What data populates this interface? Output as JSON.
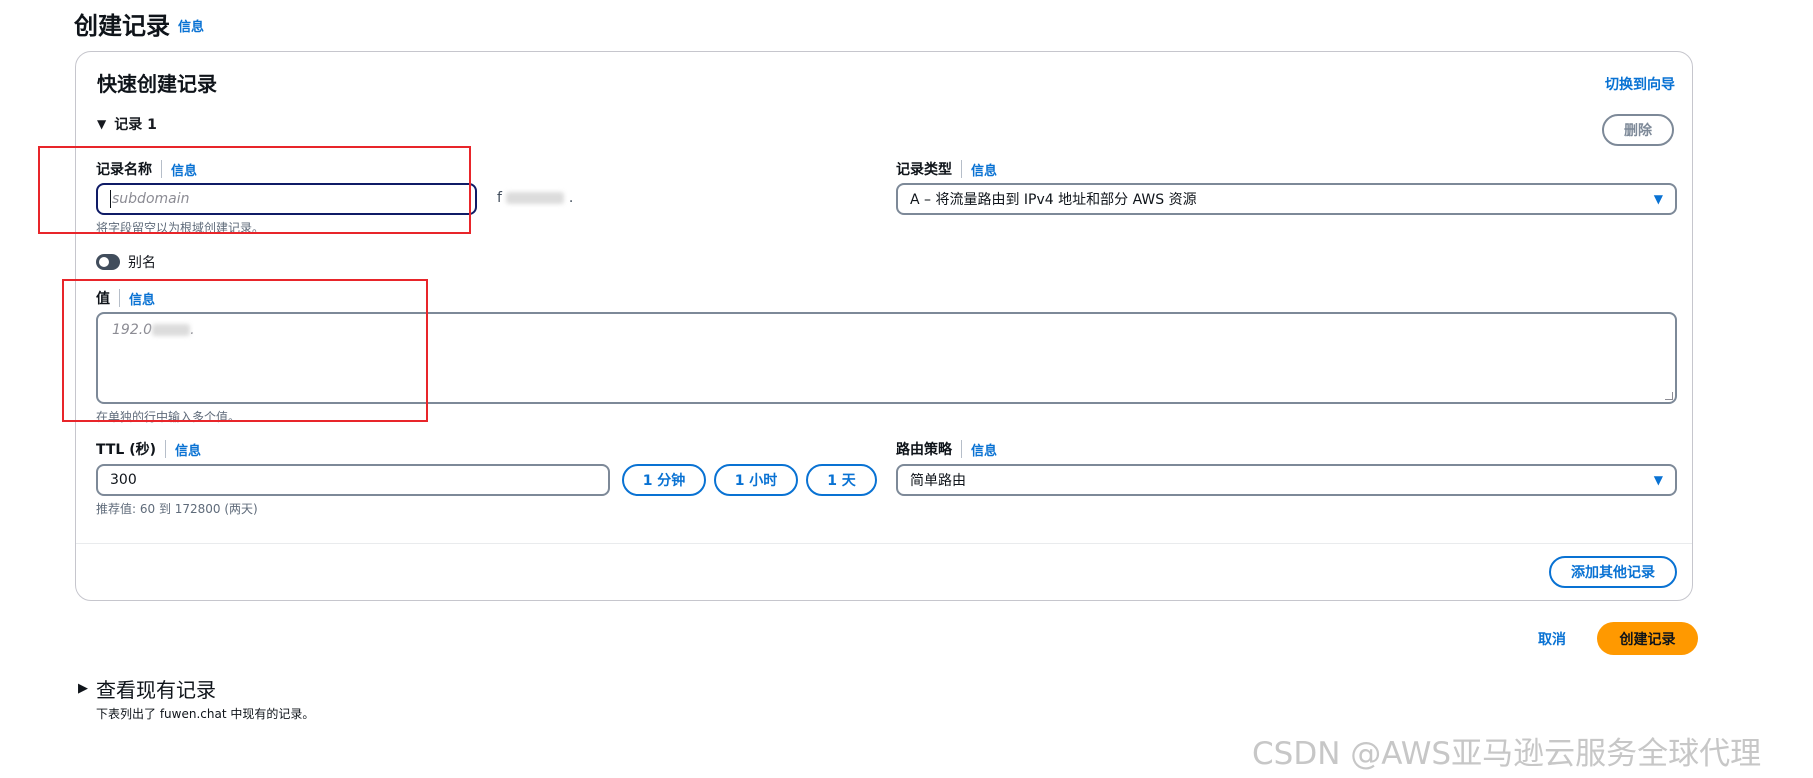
{
  "page": {
    "title": "创建记录",
    "title_info": "信息"
  },
  "panel": {
    "title": "快速创建记录",
    "switch_link": "切换到向导",
    "record_header": "记录 1",
    "delete_label": "删除",
    "add_label": "添加其他记录"
  },
  "record_name": {
    "label": "记录名称",
    "info": "信息",
    "placeholder": "subdomain",
    "suffix": "f",
    "suffix_end": ".",
    "hint": "将字段留空以为根域创建记录。"
  },
  "record_type": {
    "label": "记录类型",
    "info": "信息",
    "selected": "A – 将流量路由到 IPv4 地址和部分 AWS 资源"
  },
  "alias": {
    "label": "别名",
    "enabled": false
  },
  "value": {
    "label": "值",
    "info": "信息",
    "placeholder": "192.0",
    "placeholder_end": ".",
    "hint": "在单独的行中输入多个值。"
  },
  "ttl": {
    "label": "TTL (秒)",
    "info": "信息",
    "value": "300",
    "hint": "推荐值: 60 到 172800 (两天)",
    "buttons": [
      "1 分钟",
      "1 小时",
      "1 天"
    ]
  },
  "routing": {
    "label": "路由策略",
    "info": "信息",
    "selected": "简单路由"
  },
  "footer": {
    "cancel_label": "取消",
    "create_label": "创建记录"
  },
  "existing": {
    "header": "查看现有记录",
    "description": "下表列出了 fuwen.chat 中现有的记录。"
  },
  "watermark": "CSDN @AWS亚马逊云服务全球代理",
  "colors": {
    "accent": "#0972d3",
    "primary_button": "#ff9900",
    "highlight_box": "#e8252a"
  }
}
